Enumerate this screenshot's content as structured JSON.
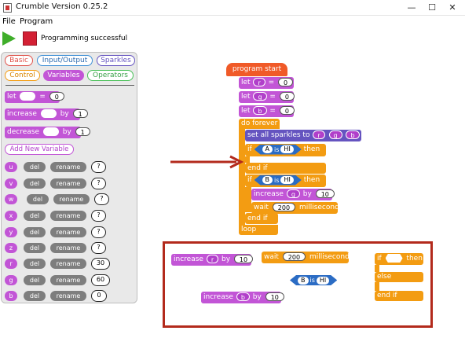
{
  "window": {
    "title": "Crumble Version 0.25.2",
    "min": "—",
    "max": "☐",
    "close": "✕"
  },
  "menu": {
    "file": "File",
    "program": "Program"
  },
  "toolbar": {
    "status": "Programming successful",
    "play_icon": "play-icon",
    "stop_icon": "stop-icon"
  },
  "palette": {
    "tabs": {
      "basic": "Basic",
      "io": "Input/Output",
      "sparkles": "Sparkles",
      "control": "Control",
      "variables": "Variables",
      "operators": "Operators"
    },
    "let": {
      "kw": "let",
      "eq": "=",
      "val": "0"
    },
    "increase": {
      "kw": "increase",
      "by": "by",
      "val": "1"
    },
    "decrease": {
      "kw": "decrease",
      "by": "by",
      "val": "1"
    },
    "add_var": "Add New Variable",
    "del": "del",
    "rename": "rename",
    "vars": [
      {
        "name": "u",
        "val": "?"
      },
      {
        "name": "v",
        "val": "?"
      },
      {
        "name": "w",
        "val": "?"
      },
      {
        "name": "x",
        "val": "?"
      },
      {
        "name": "y",
        "val": "?"
      },
      {
        "name": "z",
        "val": "?"
      },
      {
        "name": "r",
        "val": "30"
      },
      {
        "name": "g",
        "val": "60"
      },
      {
        "name": "b",
        "val": "0"
      }
    ]
  },
  "program": {
    "start": "program start",
    "let_r": {
      "kw": "let",
      "var": "r",
      "eq": "=",
      "val": "0"
    },
    "let_g": {
      "kw": "let",
      "var": "g",
      "eq": "=",
      "val": "0"
    },
    "let_b": {
      "kw": "let",
      "var": "b",
      "eq": "=",
      "val": "0"
    },
    "do_forever": "do forever",
    "set_sparkles": {
      "text": "set all sparkles to",
      "r": "r",
      "g": "g",
      "b": "b"
    },
    "if1": {
      "kw": "if",
      "a": "A",
      "is": "is",
      "hi": "HI",
      "then": "then"
    },
    "end_if1": "end if",
    "if2": {
      "kw": "if",
      "a": "B",
      "is": "is",
      "hi": "HI",
      "then": "then"
    },
    "inc_g": {
      "kw": "increase",
      "var": "g",
      "by": "by",
      "val": "10"
    },
    "wait": {
      "kw": "wait",
      "val": "200",
      "unit": "milliseconds"
    },
    "end_if2": "end if",
    "loop": "loop"
  },
  "loose": {
    "inc_r": {
      "kw": "increase",
      "var": "r",
      "by": "by",
      "val": "10"
    },
    "wait": {
      "kw": "wait",
      "val": "200",
      "unit": "milliseconds"
    },
    "b_is_hi": {
      "a": "B",
      "is": "is",
      "hi": "HI"
    },
    "inc_b": {
      "kw": "increase",
      "var": "b",
      "by": "by",
      "val": "10"
    },
    "if": {
      "kw": "if",
      "then": "then",
      "else": "else",
      "end": "end if"
    }
  }
}
